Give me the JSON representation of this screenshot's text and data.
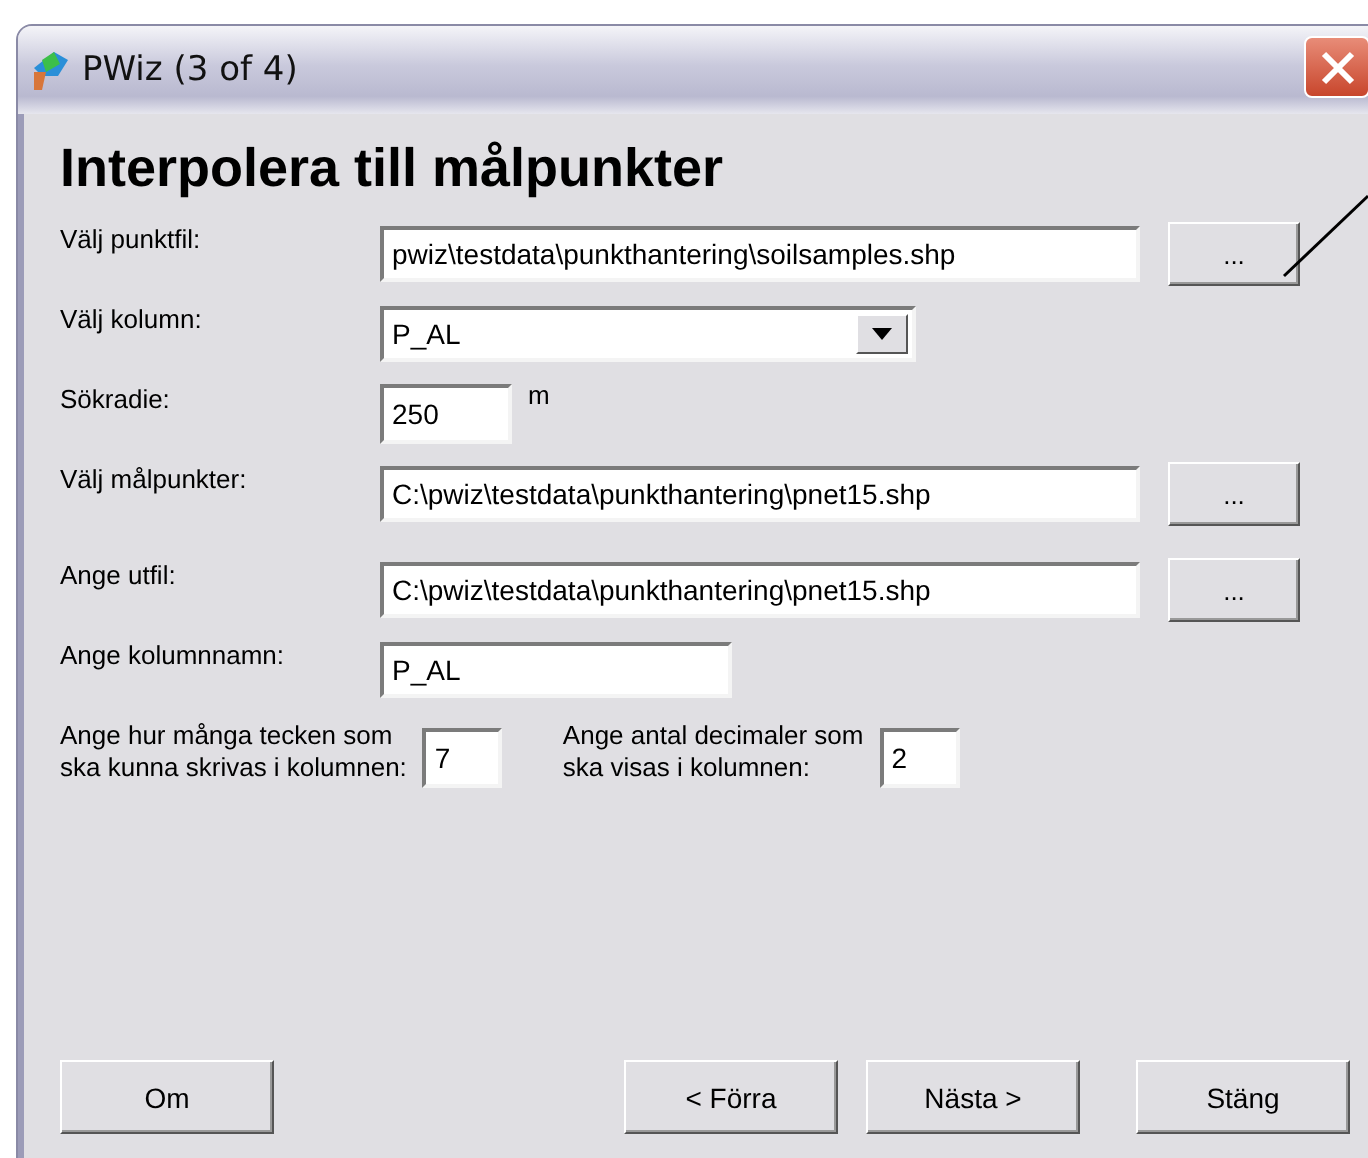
{
  "window": {
    "title": "PWiz (3 of 4)"
  },
  "heading": "Interpolera till målpunkter",
  "rows": [
    {
      "kind": "file",
      "label": "Välj punktfil:",
      "value": "pwiz\\testdata\\punkthantering\\soilsamples.shp",
      "button": "..."
    },
    {
      "kind": "dropdown",
      "label": "Välj kolumn:",
      "value": "P_AL"
    },
    {
      "kind": "number",
      "label": "Sökradie:",
      "value": "250",
      "unit": "m"
    },
    {
      "kind": "file",
      "label": "Välj målpunkter:",
      "value": "C:\\pwiz\\testdata\\punkthantering\\pnet15.shp",
      "button": "..."
    },
    {
      "kind": "file",
      "label": "Ange utfil:",
      "value": "C:\\pwiz\\testdata\\punkthantering\\pnet15.shp",
      "button": "..."
    },
    {
      "kind": "text",
      "label": "Ange kolumnnamn:",
      "value": "P_AL"
    }
  ],
  "pairs": [
    {
      "label": "Ange hur många tecken som\nska kunna skrivas i kolumnen:",
      "value": "7"
    },
    {
      "label": "Ange antal decimaler som\nska visas i kolumnen:",
      "value": "2"
    }
  ],
  "buttons": [
    "Om",
    "< Förra",
    "Nästa >",
    "Stäng"
  ]
}
